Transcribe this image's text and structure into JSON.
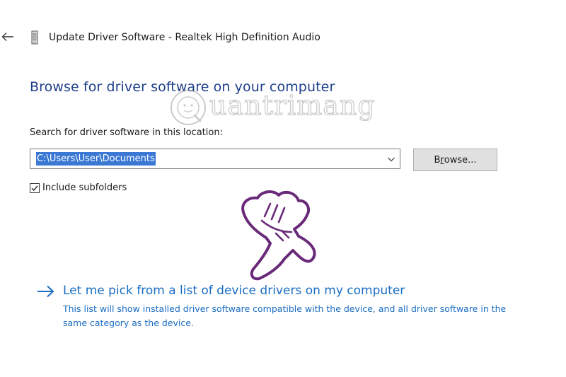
{
  "window": {
    "title": "Update Driver Software - Realtek High Definition Audio",
    "back_icon": "back-arrow-icon",
    "device_icon": "audio-device-icon"
  },
  "main": {
    "heading": "Browse for driver software on your computer",
    "search_label": "Search for driver software in this location:",
    "path_value": "C:\\Users\\User\\Documents",
    "browse_button": {
      "prefix": "B",
      "accel": "r",
      "suffix": "owse..."
    },
    "include_subfolders": {
      "label": "Include subfolders",
      "checked": true
    },
    "pick_option": {
      "link": "Let me pick from a list of device drivers on my computer",
      "description": "This list will show installed driver software compatible with the device, and all driver software in the same category as the device."
    }
  },
  "watermark": {
    "text": "uantrimang"
  },
  "colors": {
    "heading": "#1d3f8a",
    "link": "#1a6dc2",
    "selection": "#3a78d4",
    "annotation": "#6a2a7a"
  }
}
